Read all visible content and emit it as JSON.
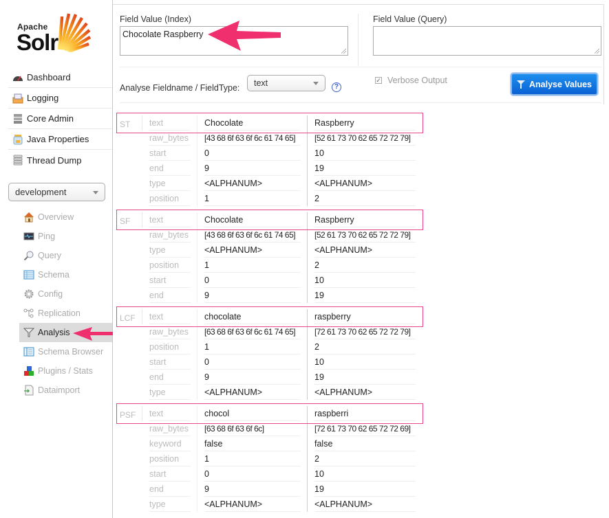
{
  "logo": {
    "line1": "Apache",
    "line2": "Solr"
  },
  "main_nav": [
    {
      "label": "Dashboard",
      "icon": "dashboard-icon"
    },
    {
      "label": "Logging",
      "icon": "logging-icon"
    },
    {
      "label": "Core Admin",
      "icon": "core-admin-icon"
    },
    {
      "label": "Java Properties",
      "icon": "java-properties-icon"
    },
    {
      "label": "Thread Dump",
      "icon": "thread-dump-icon"
    }
  ],
  "core_selector": {
    "selected": "development"
  },
  "core_nav": [
    {
      "label": "Overview",
      "icon": "overview-icon"
    },
    {
      "label": "Ping",
      "icon": "ping-icon"
    },
    {
      "label": "Query",
      "icon": "query-icon"
    },
    {
      "label": "Schema",
      "icon": "schema-icon"
    },
    {
      "label": "Config",
      "icon": "config-icon"
    },
    {
      "label": "Replication",
      "icon": "replication-icon"
    },
    {
      "label": "Analysis",
      "icon": "analysis-icon",
      "active": true
    },
    {
      "label": "Schema Browser",
      "icon": "schema-browser-icon"
    },
    {
      "label": "Plugins / Stats",
      "icon": "plugins-icon"
    },
    {
      "label": "Dataimport",
      "icon": "dataimport-icon"
    }
  ],
  "form": {
    "index_label": "Field Value (Index)",
    "index_value": "Chocolate Raspberry",
    "query_label": "Field Value (Query)",
    "query_value": "",
    "fieldtype_label": "Analyse Fieldname / FieldType:",
    "fieldtype_selected": "text",
    "help_glyph": "?",
    "verbose_label": "Verbose Output",
    "verbose_checked": true,
    "analyse_button": "Analyse Values"
  },
  "colors": {
    "highlight": "#e8488a",
    "button_blue": "#0a62d3",
    "arrow": "#f0306e"
  },
  "stages": [
    {
      "name": "ST",
      "rows": [
        {
          "key": "text",
          "v1": "Chocolate",
          "v2": "Raspberry"
        },
        {
          "key": "raw_bytes",
          "v1": "[43 68 6f 63 6f 6c 61 74 65]",
          "v2": "[52 61 73 70 62 65 72 72 79]"
        },
        {
          "key": "start",
          "v1": "0",
          "v2": "10"
        },
        {
          "key": "end",
          "v1": "9",
          "v2": "19"
        },
        {
          "key": "type",
          "v1": "<ALPHANUM>",
          "v2": "<ALPHANUM>"
        },
        {
          "key": "position",
          "v1": "1",
          "v2": "2"
        }
      ]
    },
    {
      "name": "SF",
      "rows": [
        {
          "key": "text",
          "v1": "Chocolate",
          "v2": "Raspberry"
        },
        {
          "key": "raw_bytes",
          "v1": "[43 68 6f 63 6f 6c 61 74 65]",
          "v2": "[52 61 73 70 62 65 72 72 79]"
        },
        {
          "key": "type",
          "v1": "<ALPHANUM>",
          "v2": "<ALPHANUM>"
        },
        {
          "key": "position",
          "v1": "1",
          "v2": "2"
        },
        {
          "key": "start",
          "v1": "0",
          "v2": "10"
        },
        {
          "key": "end",
          "v1": "9",
          "v2": "19"
        }
      ]
    },
    {
      "name": "LCF",
      "rows": [
        {
          "key": "text",
          "v1": "chocolate",
          "v2": "raspberry"
        },
        {
          "key": "raw_bytes",
          "v1": "[63 68 6f 63 6f 6c 61 74 65]",
          "v2": "[72 61 73 70 62 65 72 72 79]"
        },
        {
          "key": "position",
          "v1": "1",
          "v2": "2"
        },
        {
          "key": "start",
          "v1": "0",
          "v2": "10"
        },
        {
          "key": "end",
          "v1": "9",
          "v2": "19"
        },
        {
          "key": "type",
          "v1": "<ALPHANUM>",
          "v2": "<ALPHANUM>"
        }
      ]
    },
    {
      "name": "PSF",
      "rows": [
        {
          "key": "text",
          "v1": "chocol",
          "v2": "raspberri"
        },
        {
          "key": "raw_bytes",
          "v1": "[63 68 6f 63 6f 6c]",
          "v2": "[72 61 73 70 62 65 72 72 69]"
        },
        {
          "key": "keyword",
          "v1": "false",
          "v2": "false"
        },
        {
          "key": "position",
          "v1": "1",
          "v2": "2"
        },
        {
          "key": "start",
          "v1": "0",
          "v2": "10"
        },
        {
          "key": "end",
          "v1": "9",
          "v2": "19"
        },
        {
          "key": "type",
          "v1": "<ALPHANUM>",
          "v2": "<ALPHANUM>"
        }
      ]
    }
  ]
}
